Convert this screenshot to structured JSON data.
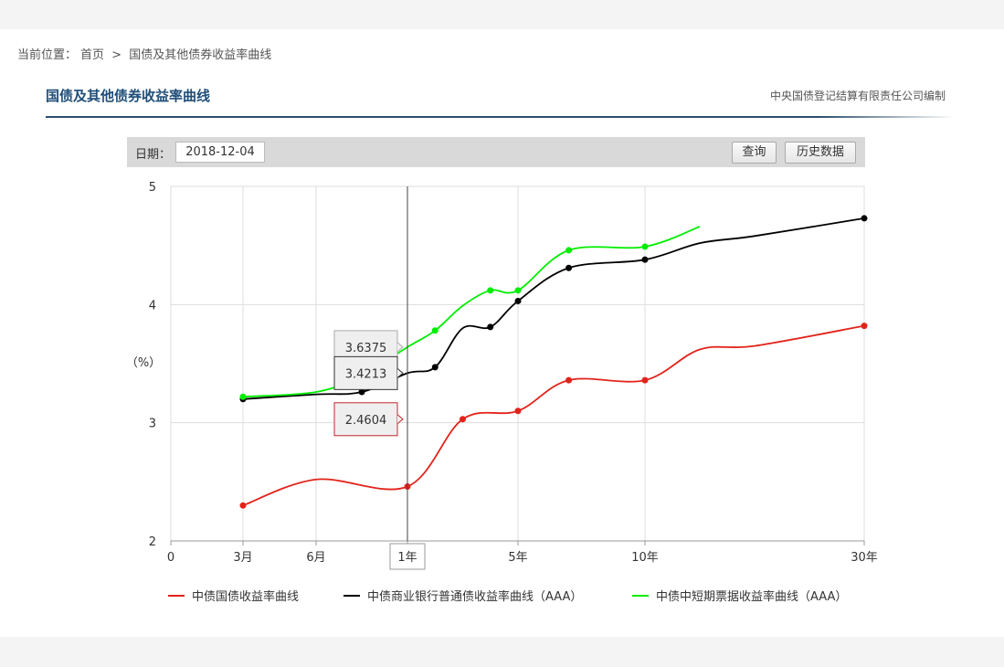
{
  "breadcrumb": {
    "label": "当前位置：",
    "home": "首页",
    "sep": ">",
    "current": "国债及其他债券收益率曲线"
  },
  "header": {
    "title": "国债及其他债券收益率曲线",
    "org": "中央国债登记结算有限责任公司编制"
  },
  "toolbar": {
    "date_label": "日期：",
    "date_value": "2018-12-04",
    "query_label": "查询",
    "history_label": "历史数据"
  },
  "tooltip": {
    "x_label": "1年",
    "values": [
      "3.6375",
      "3.4213",
      "2.4604"
    ]
  },
  "colors": {
    "treasury": "#e2231a",
    "bank": "#000000",
    "shortterm": "#00ee00"
  },
  "chart_data": {
    "type": "line",
    "xlabel": "",
    "ylabel": "（%）",
    "ylim": [
      2,
      5
    ],
    "yticks": [
      "5",
      "4",
      "3",
      "2"
    ],
    "xticks": [
      "0",
      "3月",
      "6月",
      "1年",
      "5年",
      "10年",
      "30年"
    ],
    "grid": true,
    "legend_position": "bottom",
    "series": [
      {
        "name": "中债国债收益率曲线",
        "color": "#e2231a",
        "x": [
          0.25,
          0.5,
          1,
          3,
          5,
          7,
          10,
          15,
          20,
          30
        ],
        "y": [
          2.3,
          2.52,
          2.46,
          3.03,
          3.1,
          3.36,
          3.36,
          3.62,
          3.65,
          3.82
        ],
        "markers": [
          0,
          2,
          3,
          4,
          5,
          6,
          9
        ]
      },
      {
        "name": "中债商业银行普通债收益率曲线（AAA）",
        "color": "#000000",
        "x": [
          0.25,
          0.5,
          0.75,
          1,
          2,
          3,
          4,
          5,
          7,
          10,
          15,
          20,
          30
        ],
        "y": [
          3.2,
          3.24,
          3.26,
          3.42,
          3.47,
          3.8,
          3.81,
          4.03,
          4.31,
          4.38,
          4.52,
          4.58,
          4.73
        ],
        "markers": [
          0,
          2,
          4,
          6,
          7,
          8,
          9,
          12
        ]
      },
      {
        "name": "中债中短期票据收益率曲线（AAA）",
        "color": "#00ee00",
        "x": [
          0.25,
          0.5,
          0.75,
          1,
          2,
          3,
          4,
          5,
          7,
          10,
          15
        ],
        "y": [
          3.22,
          3.26,
          3.4,
          3.64,
          3.78,
          3.99,
          4.12,
          4.12,
          4.46,
          4.49,
          4.66
        ],
        "markers": [
          0,
          4,
          6,
          7,
          8,
          9
        ]
      }
    ]
  }
}
